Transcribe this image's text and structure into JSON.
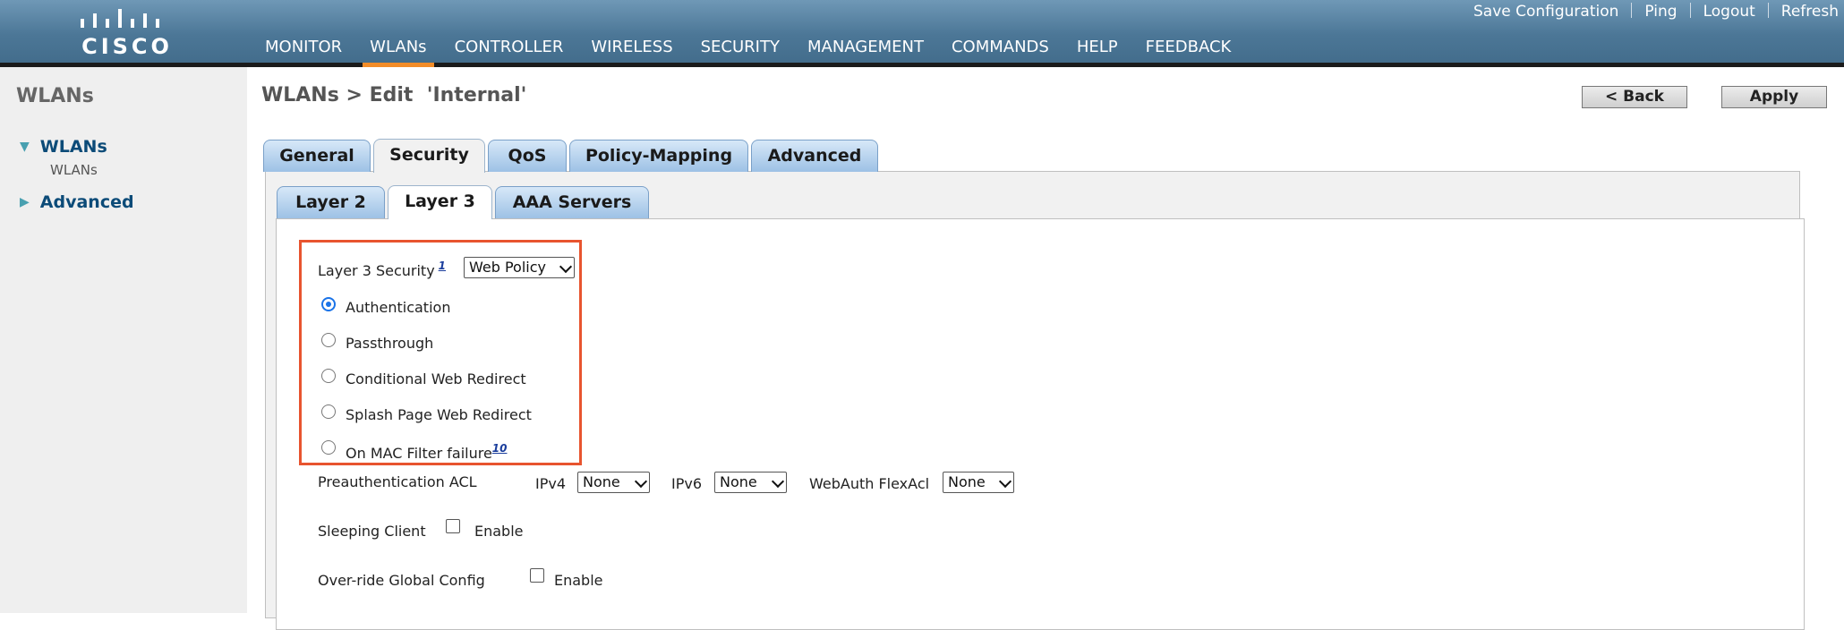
{
  "brand": {
    "wordmark": "CISCO"
  },
  "utility_links": [
    "Save Configuration",
    "Ping",
    "Logout",
    "Refresh"
  ],
  "main_nav": {
    "items": [
      "MONITOR",
      "WLANs",
      "CONTROLLER",
      "WIRELESS",
      "SECURITY",
      "MANAGEMENT",
      "COMMANDS",
      "HELP",
      "FEEDBACK"
    ],
    "active": "WLANs"
  },
  "sidebar": {
    "title": "WLANs",
    "items": [
      {
        "label": "WLANs",
        "expanded": true,
        "children": [
          "WLANs"
        ]
      },
      {
        "label": "Advanced",
        "expanded": false
      }
    ]
  },
  "page": {
    "breadcrumb": "WLANs > Edit  'Internal'",
    "back_label": "< Back",
    "apply_label": "Apply"
  },
  "tabs": {
    "primary": [
      "General",
      "Security",
      "QoS",
      "Policy-Mapping",
      "Advanced"
    ],
    "primary_active": "Security",
    "secondary": [
      "Layer 2",
      "Layer 3",
      "AAA Servers"
    ],
    "secondary_active": "Layer 3"
  },
  "layer3": {
    "security_label": "Layer 3 Security",
    "security_footnote": "1",
    "security_value": "Web Policy",
    "options": [
      {
        "label": "Authentication",
        "checked": true
      },
      {
        "label": "Passthrough",
        "checked": false
      },
      {
        "label": "Conditional Web Redirect",
        "checked": false
      },
      {
        "label": "Splash Page Web Redirect",
        "checked": false
      },
      {
        "label": "On MAC Filter failure",
        "checked": false,
        "footnote": "10"
      }
    ],
    "preauth": {
      "label": "Preauthentication ACL",
      "ipv4_label": "IPv4",
      "ipv4_value": "None",
      "ipv6_label": "IPv6",
      "ipv6_value": "None",
      "flexacl_label": "WebAuth FlexAcl",
      "flexacl_value": "None"
    },
    "sleeping_client": {
      "label": "Sleeping Client",
      "enable_label": "Enable",
      "checked": false
    },
    "override_global": {
      "label": "Over-ride Global Config",
      "enable_label": "Enable",
      "checked": false
    }
  },
  "colors": {
    "highlight_box": "#e8542f",
    "nav_active": "#f28c28",
    "header_bg": "#4c7797"
  }
}
